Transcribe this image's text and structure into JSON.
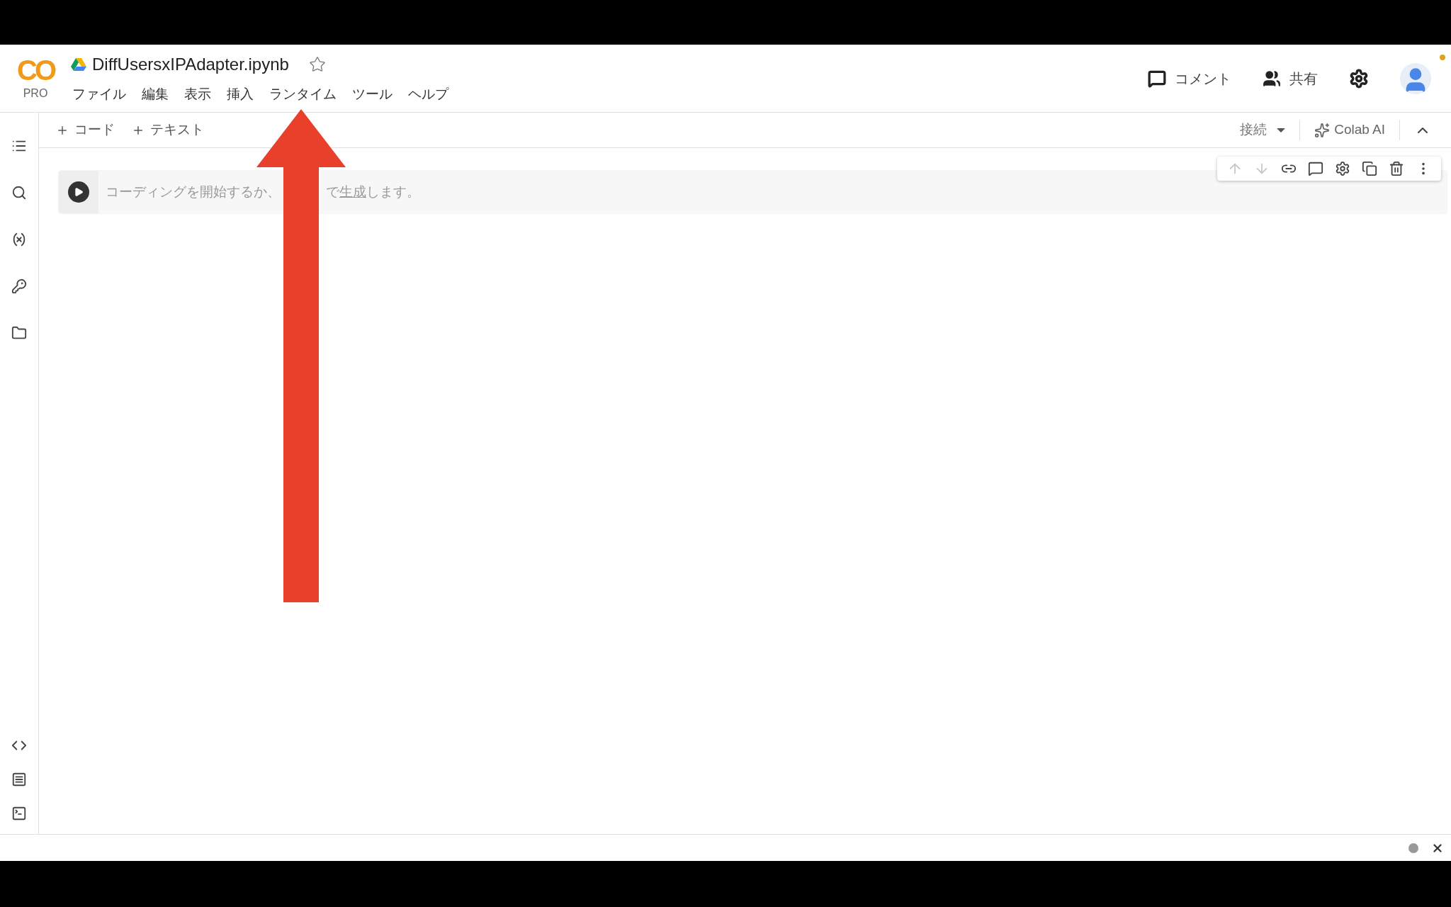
{
  "logo": {
    "text": "CO",
    "badge": "PRO"
  },
  "notebook": {
    "title": "DiffUsersxIPAdapter.ipynb",
    "starred": false
  },
  "menu": [
    "ファイル",
    "編集",
    "表示",
    "挿入",
    "ランタイム",
    "ツール",
    "ヘルプ"
  ],
  "header_actions": [
    {
      "kind": "comment",
      "label": "コメント"
    },
    {
      "kind": "share",
      "label": "共有"
    }
  ],
  "toolbar": {
    "add_buttons": [
      "コード",
      "テキスト"
    ],
    "connect": "接続",
    "ai": "Colab AI"
  },
  "sidebar": {
    "top": [
      {
        "kind": "toc"
      },
      {
        "kind": "search"
      },
      {
        "kind": "variables"
      },
      {
        "kind": "secrets"
      },
      {
        "kind": "files"
      }
    ],
    "bottom": [
      {
        "kind": "snippets"
      },
      {
        "kind": "palette"
      },
      {
        "kind": "terminal"
      }
    ]
  },
  "cell": {
    "placeholder_start": "コーディングを開始するか、",
    "placeholder_mid": "で",
    "link": "生成",
    "placeholder_end": "します。",
    "tools": [
      {
        "kind": "up",
        "disabled": true
      },
      {
        "kind": "down",
        "disabled": true
      },
      {
        "kind": "link",
        "disabled": false
      },
      {
        "kind": "comment",
        "disabled": false
      },
      {
        "kind": "settings",
        "disabled": false
      },
      {
        "kind": "mirror",
        "disabled": false
      },
      {
        "kind": "delete",
        "disabled": false
      },
      {
        "kind": "more",
        "disabled": false
      }
    ]
  }
}
